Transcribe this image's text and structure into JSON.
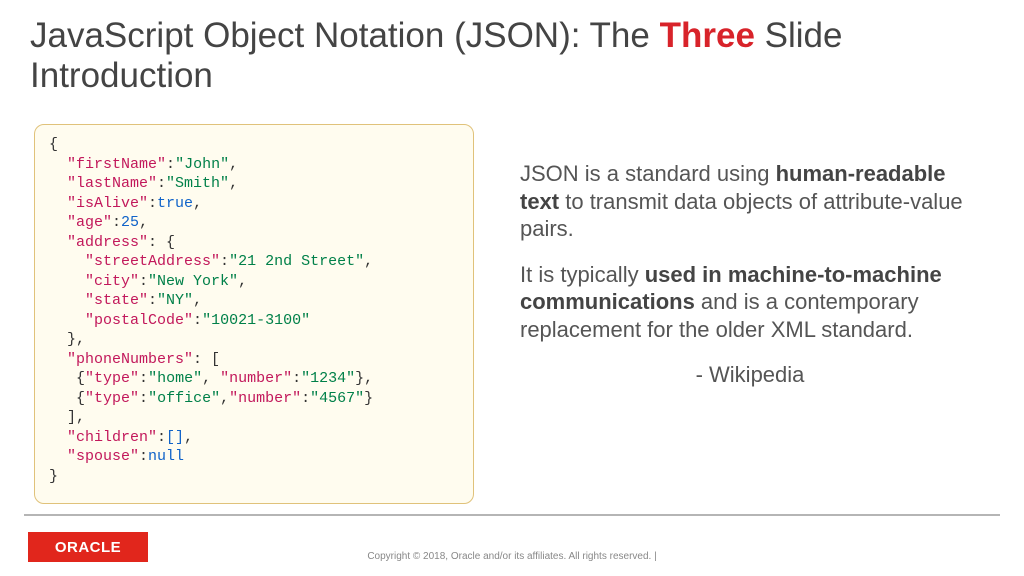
{
  "title": {
    "pre": "JavaScript Object Notation (JSON): The ",
    "highlight": "Three",
    "post": " Slide Introduction"
  },
  "code": {
    "firstName_key": "\"firstName\"",
    "firstName_val": "\"John\"",
    "lastName_key": "\"lastName\"",
    "lastName_val": "\"Smith\"",
    "isAlive_key": "\"isAlive\"",
    "isAlive_val": "true",
    "age_key": "\"age\"",
    "age_val": "25",
    "address_key": "\"address\"",
    "streetAddress_key": "\"streetAddress\"",
    "streetAddress_val": "\"21 2nd Street\"",
    "city_key": "\"city\"",
    "city_val": "\"New York\"",
    "state_key": "\"state\"",
    "state_val": "\"NY\"",
    "postalCode_key": "\"postalCode\"",
    "postalCode_val": "\"10021-3100\"",
    "phoneNumbers_key": "\"phoneNumbers\"",
    "type_key": "\"type\"",
    "home_val": "\"home\"",
    "number_key": "\"number\"",
    "num1_val": "\"1234\"",
    "office_val": "\"office\"",
    "num2_val": "\"4567\"",
    "children_key": "\"children\"",
    "children_val": "[]",
    "spouse_key": "\"spouse\"",
    "spouse_val": "null"
  },
  "desc": {
    "p1a": "JSON is a standard using ",
    "p1b": "human-readable text",
    "p1c": " to transmit data objects of attribute-value pairs.",
    "p2a": "It is typically ",
    "p2b": "used in machine-to-machine communications",
    "p2c": " and is a contemporary replacement for the older XML standard.",
    "attrib": "- Wikipedia"
  },
  "footer": {
    "logo": "ORACLE",
    "copyright": "Copyright © 2018, Oracle and/or its affiliates. All rights reserved.  |"
  }
}
